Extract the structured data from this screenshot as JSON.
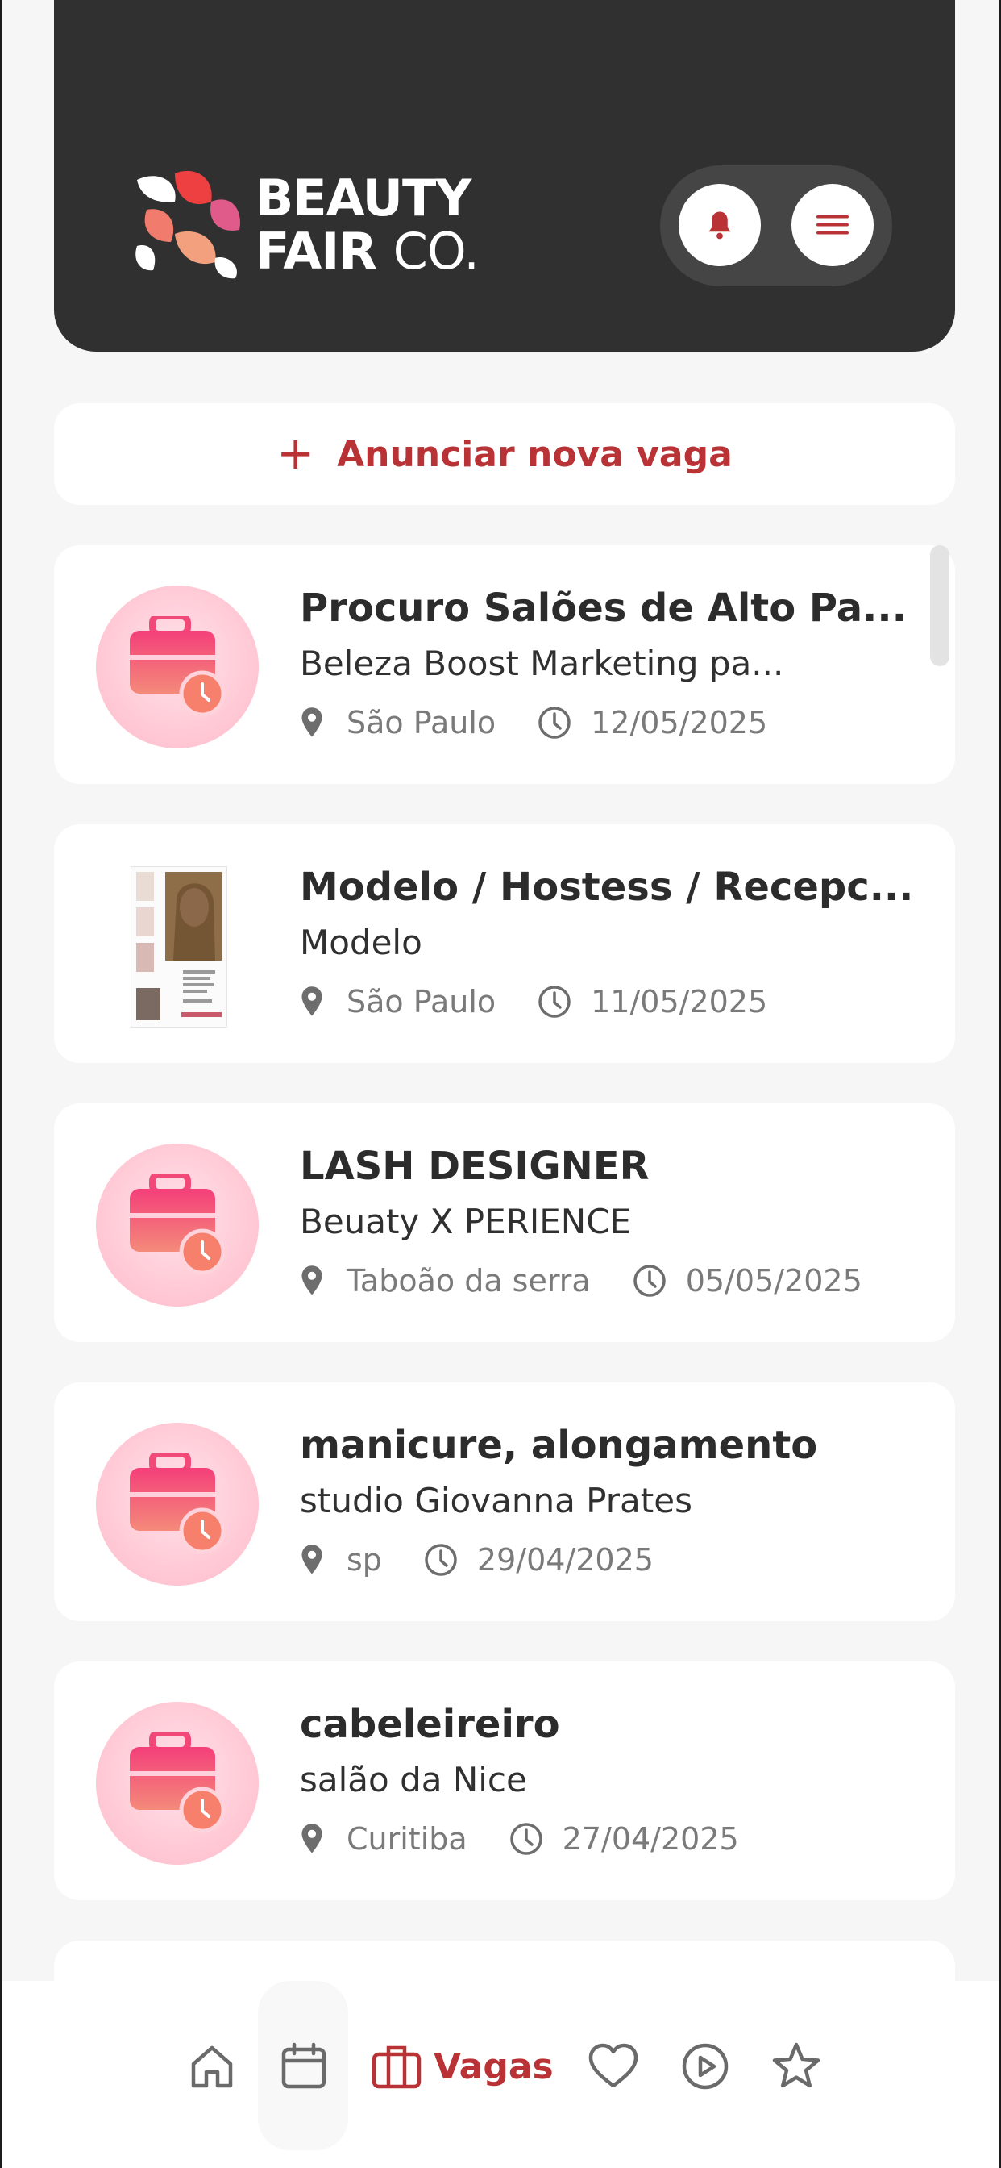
{
  "brand": {
    "name_line1": "BEAUTY",
    "name_line2_a": "FAIR",
    "name_line2_b": "CO."
  },
  "header": {
    "notifications_icon": "bell-icon",
    "menu_icon": "hamburger-menu-icon"
  },
  "announce": {
    "label": "Anunciar nova vaga",
    "icon": "plus-icon"
  },
  "jobs": [
    {
      "title": "Procuro Salões de Alto Pa...",
      "company": "Beleza Boost Marketing pa...",
      "location": "São Paulo",
      "date": "12/05/2025",
      "image": "briefcase-clock-icon"
    },
    {
      "title": "Modelo / Hostess / Recepc...",
      "company": "Modelo",
      "location": "São Paulo",
      "date": "11/05/2025",
      "image": "photo-thumbnail"
    },
    {
      "title": "LASH DESIGNER",
      "company": "Beuaty X PERIENCE",
      "location": "Taboão da serra",
      "date": "05/05/2025",
      "image": "briefcase-clock-icon"
    },
    {
      "title": "manicure, alongamento",
      "company": "studio Giovanna Prates",
      "location": "sp",
      "date": "29/04/2025",
      "image": "briefcase-clock-icon"
    },
    {
      "title": "cabeleireiro",
      "company": "salão da Nice",
      "location": "Curitiba",
      "date": "27/04/2025",
      "image": "briefcase-clock-icon"
    }
  ],
  "bottom_nav": {
    "items": [
      {
        "icon": "home-icon"
      },
      {
        "icon": "calendar-icon"
      },
      {
        "icon": "briefcase-icon",
        "label": "Vagas",
        "active": true
      },
      {
        "icon": "heart-icon"
      },
      {
        "icon": "play-circle-icon"
      },
      {
        "icon": "star-icon"
      }
    ]
  },
  "colors": {
    "header_bg": "#303030",
    "accent": "#b83236",
    "card_bg": "#ffffff",
    "page_bg": "#f6f6f6"
  }
}
